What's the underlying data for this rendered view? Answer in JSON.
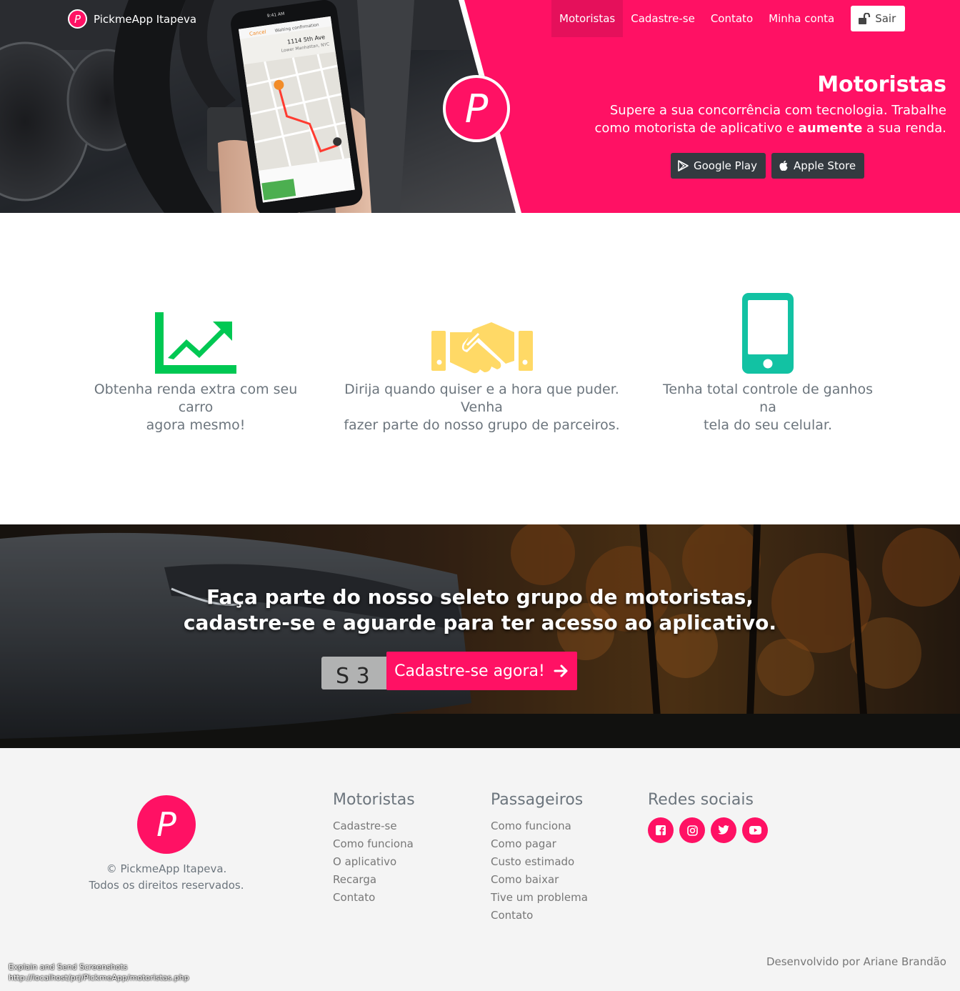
{
  "nav": {
    "brand": "PickmeApp Itapeva",
    "brand_logo_letter": "P",
    "links": [
      "Motoristas",
      "Cadastre-se",
      "Contato",
      "Minha conta"
    ],
    "logout_label": "Sair"
  },
  "hero": {
    "logo_letter": "P",
    "title": "Motoristas",
    "subtitle_before": "Supere a sua concorrência com tecnologia. Trabalhe como motorista de aplicativo e ",
    "subtitle_bold": "aumente",
    "subtitle_after": " a sua renda.",
    "google_play_label": "Google Play",
    "apple_store_label": "Apple Store",
    "phone_screen": {
      "cancel": "Cancel",
      "status": "Waiting confirmation",
      "address": "1114 5th Ave",
      "area": "Lower Manhattan, NYC",
      "time": "9:41 AM"
    }
  },
  "features": [
    {
      "icon": "chart-line-icon",
      "color": "#00c853",
      "text_line1": "Obtenha renda extra com seu carro",
      "text_line2": "agora mesmo!"
    },
    {
      "icon": "handshake-icon",
      "color": "#ffd966",
      "text_line1": "Dirija quando quiser e a hora que puder. Venha",
      "text_line2": "fazer parte do nosso grupo de parceiros."
    },
    {
      "icon": "mobile-phone-icon",
      "color": "#12c2a3",
      "text_line1": "Tenha total controle de ganhos na",
      "text_line2": "tela do seu celular."
    }
  ],
  "cta": {
    "heading_line1": "Faça parte do nosso seleto grupo de motoristas,",
    "heading_line2": "cadastre-se e aguarde para ter acesso ao aplicativo.",
    "button_label": "Cadastre-se agora!",
    "plate_text": "S 3"
  },
  "footer": {
    "logo_letter": "P",
    "copyright_line1": "© PickmeApp Itapeva.",
    "copyright_line2": "Todos os direitos reservados.",
    "motoristas": {
      "title": "Motoristas",
      "links": [
        "Cadastre-se",
        "Como funciona",
        "O aplicativo",
        "Recarga",
        "Contato"
      ]
    },
    "passageiros": {
      "title": "Passageiros",
      "links": [
        "Como funciona",
        "Como pagar",
        "Custo estimado",
        "Como baixar",
        "Tive um problema",
        "Contato"
      ]
    },
    "redes": {
      "title": "Redes sociais",
      "icons": [
        "facebook-icon",
        "instagram-icon",
        "twitter-icon",
        "youtube-icon"
      ]
    },
    "credit": "Desenvolvido por Ariane Brandão",
    "tooltip_line1": "Explain and Send Screenshots",
    "tooltip_line2": "http://localhost/prj/PickmeApp/motoristas.php"
  },
  "colors": {
    "brand_pink": "#ff1164",
    "dark_button": "#343a40"
  }
}
